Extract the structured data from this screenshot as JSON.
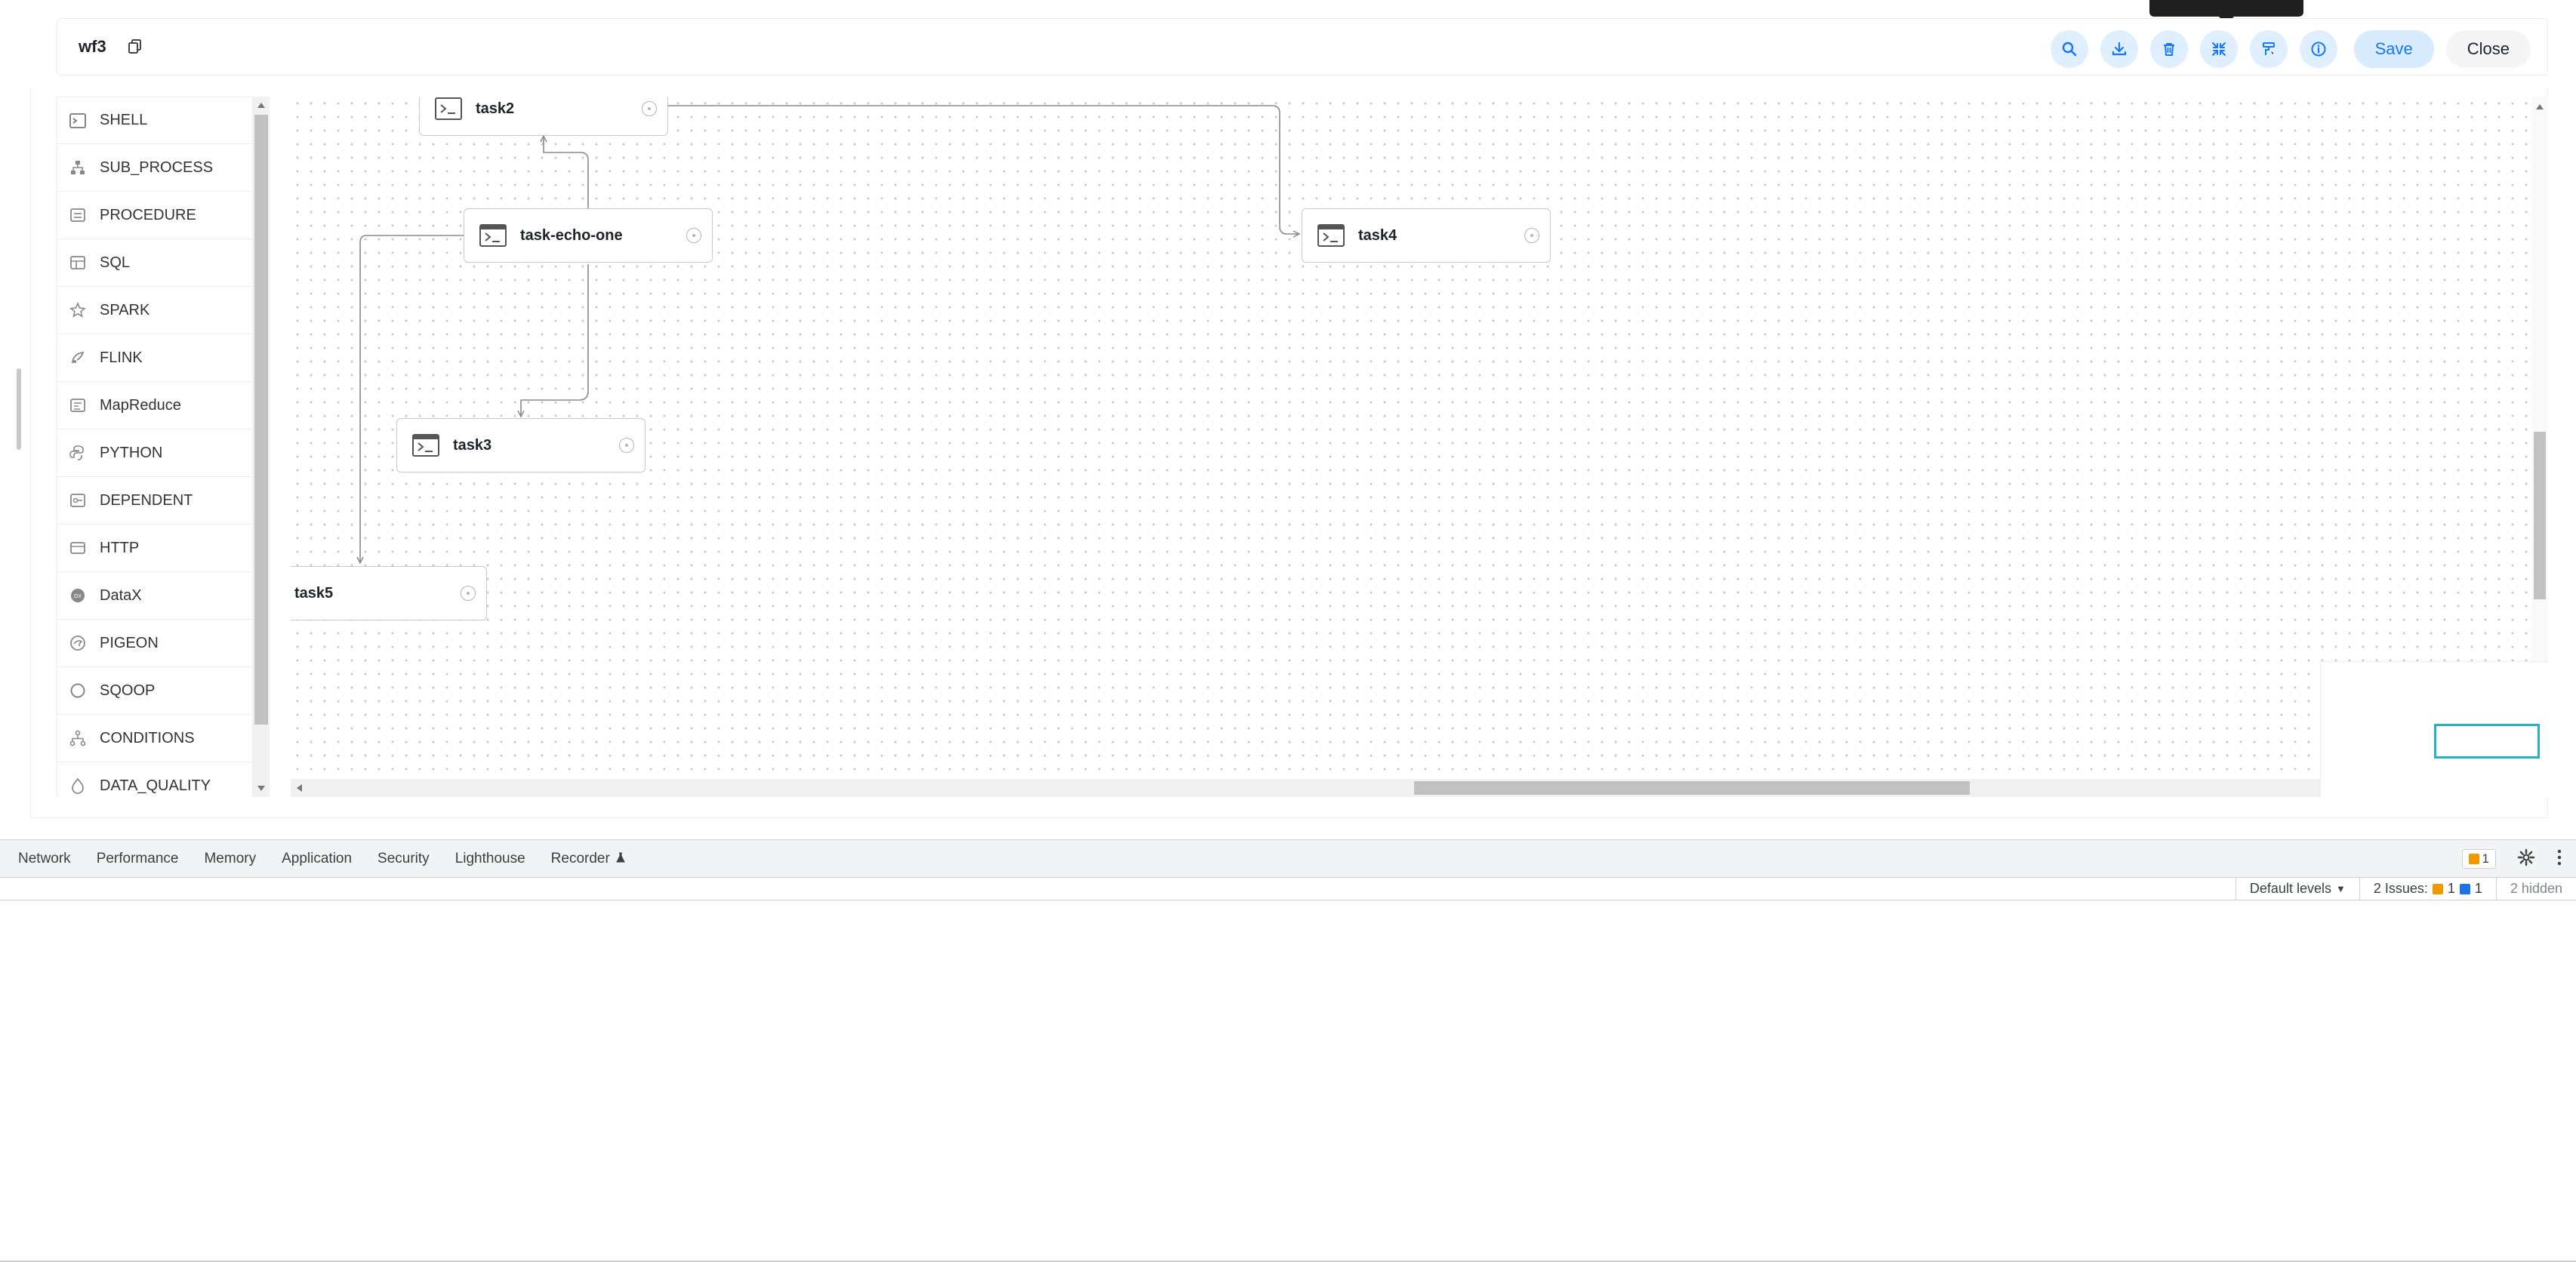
{
  "header": {
    "title": "wf3",
    "save_label": "Save",
    "close_label": "Close"
  },
  "task_types": [
    {
      "label": "SHELL",
      "icon": "shell-icon"
    },
    {
      "label": "SUB_PROCESS",
      "icon": "sub-process-icon"
    },
    {
      "label": "PROCEDURE",
      "icon": "procedure-icon"
    },
    {
      "label": "SQL",
      "icon": "sql-icon"
    },
    {
      "label": "SPARK",
      "icon": "spark-icon"
    },
    {
      "label": "FLINK",
      "icon": "flink-icon"
    },
    {
      "label": "MapReduce",
      "icon": "mapreduce-icon"
    },
    {
      "label": "PYTHON",
      "icon": "python-icon"
    },
    {
      "label": "DEPENDENT",
      "icon": "dependent-icon"
    },
    {
      "label": "HTTP",
      "icon": "http-icon"
    },
    {
      "label": "DataX",
      "icon": "datax-icon"
    },
    {
      "label": "PIGEON",
      "icon": "pigeon-icon"
    },
    {
      "label": "SQOOP",
      "icon": "sqoop-icon"
    },
    {
      "label": "CONDITIONS",
      "icon": "conditions-icon"
    },
    {
      "label": "DATA_QUALITY",
      "icon": "data-quality-icon"
    }
  ],
  "nodes": {
    "task2": "task2",
    "task_echo_one": "task-echo-one",
    "task4": "task4",
    "task3": "task3",
    "task5": "task5"
  },
  "devtools": {
    "tabs": [
      "Network",
      "Performance",
      "Memory",
      "Application",
      "Security",
      "Lighthouse",
      "Recorder"
    ],
    "warning_count": "1",
    "default_levels": "Default levels",
    "issues_label": "2 Issues:",
    "issues_warn": "1",
    "issues_info": "1",
    "hidden_label": "2 hidden"
  },
  "colors": {
    "accent": "#1677ff",
    "tool_bg": "#e0efff",
    "minimap_viewport": "#25b2c4",
    "warn": "#f29900",
    "info": "#1a73e8"
  }
}
